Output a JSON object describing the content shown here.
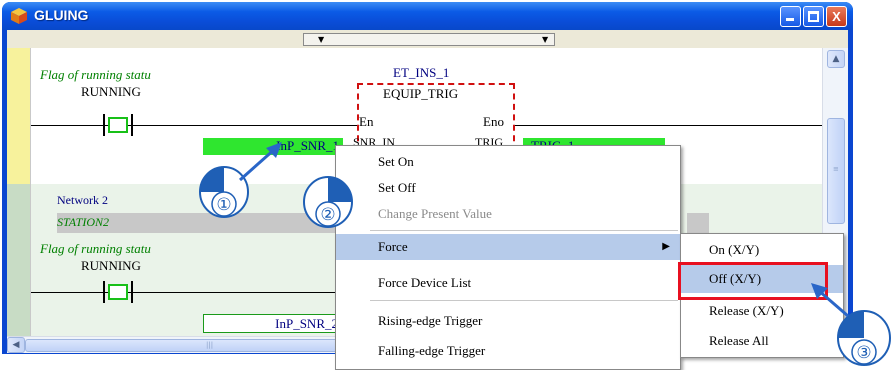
{
  "window": {
    "title": "GLUING",
    "min_label": "",
    "max_label": "",
    "close_label": "X"
  },
  "network1": {
    "comment": "Flag of running statu",
    "contact_label": "RUNNING",
    "input_var": "InP_SNR_1",
    "output_var": "TRIG_1"
  },
  "function_block": {
    "instance": "ET_INS_1",
    "type": "EQUIP_TRIG",
    "pin_en": "En",
    "pin_eno": "Eno",
    "pin_in": "SNR_IN",
    "pin_out": "TRIG"
  },
  "network2": {
    "label": "Network 2",
    "station": "STATION2",
    "comment": "Flag of running statu",
    "contact_label": "RUNNING",
    "input_var": "InP_SNR_2"
  },
  "context_menu": {
    "items": [
      {
        "label": "Set On"
      },
      {
        "label": "Set Off"
      },
      {
        "label": "Change Present Value"
      },
      {
        "label": "Force"
      },
      {
        "label": "Force Device List"
      },
      {
        "label": "Rising-edge Trigger"
      },
      {
        "label": "Falling-edge Trigger"
      }
    ],
    "submenu": [
      {
        "label": "On (X/Y)"
      },
      {
        "label": "Off (X/Y)"
      },
      {
        "label": "Release (X/Y)"
      },
      {
        "label": "Release All"
      }
    ]
  },
  "steps": {
    "step1": "①",
    "step2": "②",
    "step3": "③"
  },
  "colors": {
    "titlebar": "#0a4dd8",
    "highlight": "#b6cbea",
    "callout_frame": "#e81020",
    "variable_fill": "#2fe62f",
    "mouse_blue": "#1f5fb5"
  }
}
